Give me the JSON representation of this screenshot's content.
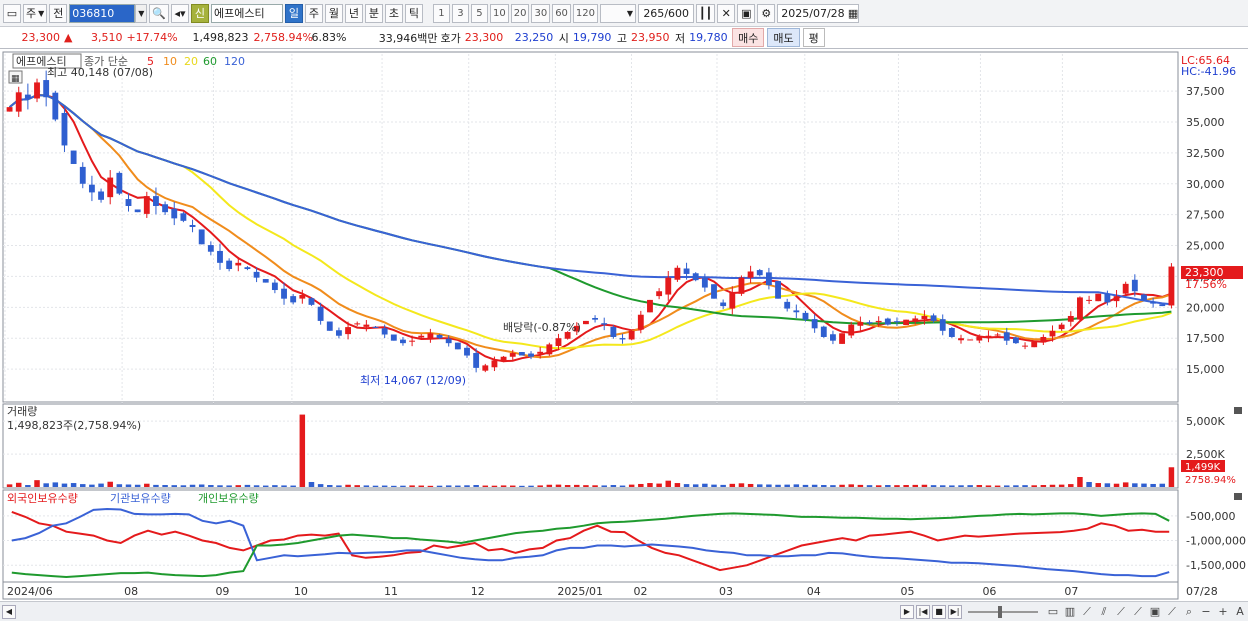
{
  "toolbar": {
    "market": "주",
    "prev": "전",
    "code": "036810",
    "badge": "신",
    "name": "에프에스티",
    "periods": [
      "일",
      "주",
      "월",
      "년",
      "분",
      "초",
      "틱"
    ],
    "intervals": [
      "1",
      "3",
      "5",
      "10",
      "20",
      "30",
      "60",
      "120"
    ],
    "count": "265",
    "count_total": "/600",
    "date": "2025/07/28"
  },
  "quote": {
    "price": "23,300",
    "arrow": "▲",
    "change": "3,510",
    "change_pct": "+17.74%",
    "volume": "1,498,823",
    "volume_ratio": "2,758.94%",
    "turnover_pct": "6.83%",
    "amount": "33,946백만",
    "hoga_label": "호가",
    "ask": "23,300",
    "bid": "23,250",
    "open_label": "시",
    "open": "19,790",
    "high_label": "고",
    "high": "23,950",
    "low_label": "저",
    "low": "19,780",
    "buy_button": "매수",
    "sell_button": "매도",
    "eval_button": "평"
  },
  "chart_data": [
    {
      "type": "candlestick",
      "title": "에프에스티",
      "legend": [
        "종가 단순",
        "5",
        "10",
        "20",
        "60",
        "120"
      ],
      "series_colors": {
        "ma5": "#e41a1c",
        "ma10": "#f08c1c",
        "ma20": "#f4e81c",
        "ma60": "#1f9a2e",
        "ma120": "#3a62d6",
        "up": "#e41a1c",
        "down": "#2f5fd0"
      },
      "ylim": [
        12500,
        40500
      ],
      "y_ticks": [
        "37,500",
        "35,000",
        "32,500",
        "30,000",
        "27,500",
        "25,000",
        "22,500",
        "20,000",
        "17,500",
        "15,000"
      ],
      "y_tick_values": [
        37500,
        35000,
        32500,
        30000,
        27500,
        25000,
        22500,
        20000,
        17500,
        15000
      ],
      "x_ticks": [
        "2024/06",
        "08",
        "09",
        "10",
        "11",
        "12",
        "2025/01",
        "02",
        "03",
        "04",
        "05",
        "06",
        "07"
      ],
      "x_axis_end_label": "07/28",
      "high_annotation": "최고 40,148 (07/08)",
      "low_annotation": "최저 14,067 (12/09)",
      "dividend_annotation": "배당락(-0.87%)",
      "right_labels": [
        "LC:65.64",
        "HC:-41.96"
      ],
      "last_price_label": "23,300",
      "last_change_label": "17.56%",
      "closes": [
        36200,
        37400,
        36900,
        38200,
        37000,
        35200,
        33100,
        31600,
        30000,
        29300,
        28700,
        30500,
        29200,
        28200,
        27700,
        29000,
        28200,
        27700,
        27200,
        27000,
        26500,
        25100,
        24500,
        23600,
        23100,
        23600,
        23100,
        22400,
        22000,
        21400,
        20700,
        20400,
        21000,
        20200,
        18900,
        18100,
        17700,
        18400,
        18700,
        18600,
        18400,
        17800,
        17300,
        17100,
        17300,
        17700,
        17900,
        17500,
        17100,
        16600,
        16100,
        15100,
        15300,
        15700,
        16000,
        16300,
        16100,
        16000,
        16400,
        17000,
        17500,
        18000,
        18500,
        18900,
        19000,
        18600,
        17600,
        17400,
        18100,
        19400,
        20600,
        21300,
        22400,
        23200,
        22700,
        22200,
        21600,
        20700,
        20100,
        21200,
        22400,
        22900,
        22600,
        21800,
        20700,
        19900,
        19600,
        19000,
        18300,
        17600,
        17300,
        17900,
        18600,
        18800,
        18700,
        18900,
        18600,
        18800,
        19000,
        19100,
        19300,
        18900,
        18100,
        17600,
        17500,
        17400,
        17600,
        17700,
        17800,
        17300,
        17100,
        16900,
        17200,
        17600,
        18100,
        18600,
        19300,
        20800,
        20600,
        21100,
        20400,
        20900,
        21900,
        21300,
        20600,
        20300,
        20100,
        23300
      ]
    },
    {
      "type": "bar",
      "title": "거래량",
      "value_label": "1,498,823주(2,758.94%)",
      "ylim": [
        0,
        6000000
      ],
      "y_ticks": [
        "5,000K",
        "2,500K"
      ],
      "y_tick_values": [
        5000000,
        2500000
      ],
      "last_label": "1,499K",
      "last_ratio_label": "2758.94%",
      "values": [
        200000,
        320000,
        150000,
        520000,
        280000,
        350000,
        260000,
        300000,
        220000,
        180000,
        260000,
        400000,
        210000,
        190000,
        170000,
        250000,
        160000,
        150000,
        140000,
        130000,
        170000,
        190000,
        150000,
        130000,
        120000,
        140000,
        160000,
        130000,
        110000,
        140000,
        120000,
        110000,
        5500000,
        380000,
        220000,
        150000,
        120000,
        170000,
        140000,
        120000,
        100000,
        110000,
        90000,
        100000,
        120000,
        110000,
        90000,
        100000,
        120000,
        110000,
        130000,
        150000,
        110000,
        100000,
        120000,
        110000,
        90000,
        100000,
        120000,
        170000,
        180000,
        150000,
        160000,
        140000,
        130000,
        120000,
        150000,
        110000,
        180000,
        230000,
        300000,
        260000,
        480000,
        300000,
        220000,
        200000,
        250000,
        180000,
        160000,
        240000,
        280000,
        230000,
        200000,
        190000,
        170000,
        180000,
        200000,
        160000,
        170000,
        150000,
        140000,
        170000,
        200000,
        160000,
        140000,
        130000,
        150000,
        140000,
        150000,
        160000,
        170000,
        140000,
        130000,
        120000,
        130000,
        140000,
        150000,
        120000,
        110000,
        120000,
        130000,
        140000,
        130000,
        150000,
        170000,
        180000,
        220000,
        760000,
        380000,
        300000,
        280000,
        250000,
        350000,
        280000,
        260000,
        230000,
        250000,
        1498823
      ]
    },
    {
      "type": "line",
      "title": "보유수량",
      "series_names": [
        "외국인보유수량",
        "기관보유수량",
        "개인보유수량"
      ],
      "series_colors": [
        "#e41a1c",
        "#3a62d6",
        "#1f9a2e"
      ],
      "ylim": [
        -1800000,
        -300000
      ],
      "y_ticks": [
        "-500,000",
        "-1,000,000",
        "-1,500,000"
      ],
      "y_tick_values": [
        -500000,
        -1000000,
        -1500000
      ],
      "series": [
        {
          "name": "외국인보유수량",
          "values": [
            -420000,
            -520000,
            -650000,
            -700000,
            -820000,
            -860000,
            -900000,
            -1000000,
            -1050000,
            -900000,
            -800000,
            -880000,
            -820000,
            -900000,
            -1000000,
            -1050000,
            -1150000,
            -1200000,
            -1100000,
            -1000000,
            -980000,
            -900000,
            -880000,
            -900000,
            -860000,
            -1300000,
            -1350000,
            -1330000,
            -1300000,
            -1250000,
            -1230000,
            -1100000,
            -1150000,
            -1100000,
            -1050000,
            -1200000,
            -1170000,
            -1250000,
            -1180000,
            -1150000,
            -1000000,
            -950000,
            -800000,
            -700000,
            -820000,
            -830000,
            -1000000,
            -1150000,
            -1250000,
            -1300000,
            -1400000,
            -1500000,
            -1600000,
            -1550000,
            -1500000,
            -1400000,
            -1300000,
            -1200000,
            -1100000,
            -1050000,
            -1000000,
            -950000,
            -1000000,
            -900000,
            -880000,
            -850000,
            -820000,
            -900000,
            -1000000,
            -950000,
            -900000,
            -920000,
            -900000,
            -880000,
            -860000,
            -850000,
            -840000,
            -830000,
            -800000,
            -760000,
            -650000,
            -700000,
            -800000,
            -780000,
            -820000,
            -820000
          ]
        },
        {
          "name": "기관보유수량",
          "values": [
            -1000000,
            -950000,
            -850000,
            -700000,
            -650000,
            -520000,
            -380000,
            -360000,
            -370000,
            -460000,
            -470000,
            -470000,
            -460000,
            -470000,
            -600000,
            -650000,
            -600000,
            -700000,
            -1400000,
            -1350000,
            -1300000,
            -1320000,
            -1300000,
            -1280000,
            -1250000,
            -1260000,
            -1250000,
            -1240000,
            -1230000,
            -1200000,
            -1200000,
            -1250000,
            -1300000,
            -1350000,
            -1380000,
            -1400000,
            -1400000,
            -1350000,
            -1330000,
            -1300000,
            -1200000,
            -1150000,
            -1150000,
            -1100000,
            -1100000,
            -1120000,
            -1100000,
            -1080000,
            -1100000,
            -1120000,
            -1150000,
            -1200000,
            -1230000,
            -1250000,
            -1300000,
            -1300000,
            -1320000,
            -1320000,
            -1300000,
            -1300000,
            -1250000,
            -1260000,
            -1300000,
            -1330000,
            -1350000,
            -1360000,
            -1380000,
            -1400000,
            -1420000,
            -1450000,
            -1450000,
            -1460000,
            -1480000,
            -1500000,
            -1520000,
            -1550000,
            -1580000,
            -1600000,
            -1620000,
            -1650000,
            -1680000,
            -1700000,
            -1700000,
            -1720000,
            -1720000,
            -1640000
          ]
        },
        {
          "name": "개인보유수량",
          "values": [
            -1650000,
            -1680000,
            -1700000,
            -1720000,
            -1740000,
            -1720000,
            -1700000,
            -1680000,
            -1660000,
            -1660000,
            -1650000,
            -1680000,
            -1700000,
            -1710000,
            -1720000,
            -1700000,
            -1650000,
            -1620000,
            -1100000,
            -1100000,
            -1080000,
            -1050000,
            -1000000,
            -950000,
            -900000,
            -880000,
            -900000,
            -920000,
            -950000,
            -950000,
            -980000,
            -1000000,
            -1020000,
            -1050000,
            -1000000,
            -950000,
            -900000,
            -850000,
            -820000,
            -800000,
            -760000,
            -740000,
            -700000,
            -650000,
            -630000,
            -620000,
            -600000,
            -580000,
            -560000,
            -530000,
            -500000,
            -480000,
            -460000,
            -450000,
            -460000,
            -470000,
            -480000,
            -500000,
            -520000,
            -520000,
            -530000,
            -540000,
            -540000,
            -550000,
            -560000,
            -560000,
            -570000,
            -560000,
            -550000,
            -540000,
            -520000,
            -500000,
            -490000,
            -470000,
            -460000,
            -470000,
            -460000,
            -450000,
            -450000,
            -470000,
            -500000,
            -480000,
            -460000,
            -450000,
            -460000,
            -600000
          ]
        }
      ]
    }
  ],
  "scrollbar": {
    "left_arrow": "◀",
    "right_arrow": "▶"
  }
}
